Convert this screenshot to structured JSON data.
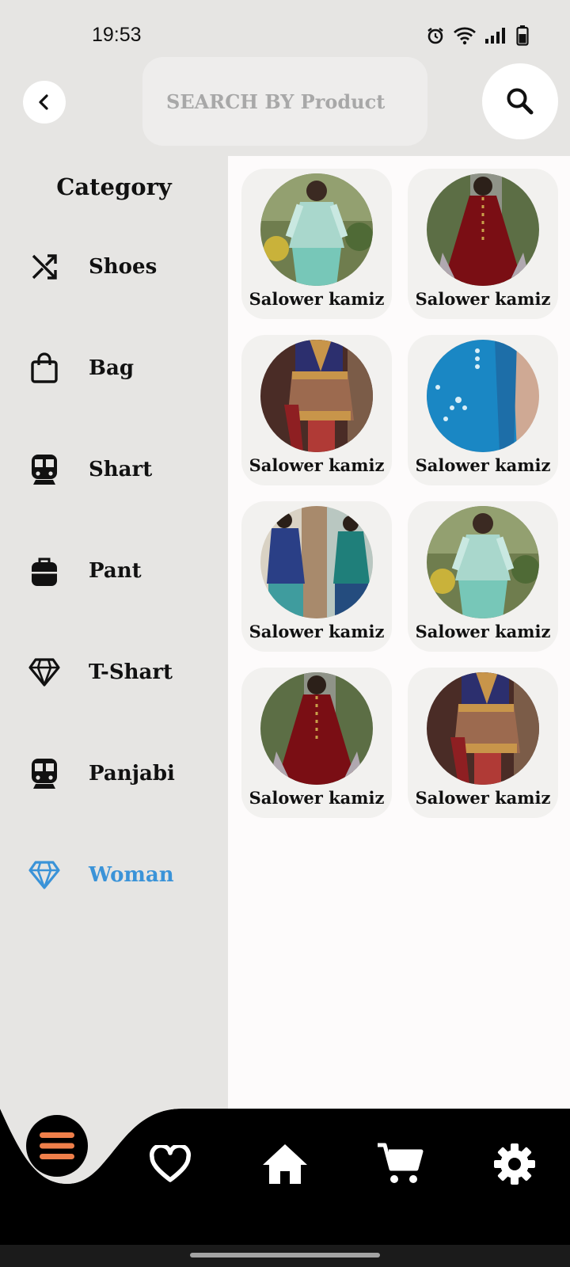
{
  "status_bar": {
    "time": "19:53"
  },
  "header": {
    "search_placeholder": "SEARCH BY Product"
  },
  "sidebar": {
    "title": "Category",
    "items": [
      {
        "label": "Shoes",
        "icon": "shuffle-icon"
      },
      {
        "label": "Bag",
        "icon": "shopping-bag-icon"
      },
      {
        "label": "Shart",
        "icon": "train-icon"
      },
      {
        "label": "Pant",
        "icon": "suitcase-icon"
      },
      {
        "label": "T-Shart",
        "icon": "diamond-icon"
      },
      {
        "label": "Panjabi",
        "icon": "train-icon"
      },
      {
        "label": "Woman",
        "icon": "diamond-icon",
        "active": true
      }
    ],
    "active_color": "#3a93d8"
  },
  "products": [
    {
      "name": "Salower kamiz",
      "outfit": "mint"
    },
    {
      "name": "Salower kamiz",
      "outfit": "maroon"
    },
    {
      "name": "Salower kamiz",
      "outfit": "navy-embroidered"
    },
    {
      "name": "Salower kamiz",
      "outfit": "teal-blue"
    },
    {
      "name": "Salower kamiz",
      "outfit": "navy-teal-duo"
    },
    {
      "name": "Salower kamiz",
      "outfit": "mint"
    },
    {
      "name": "Salower kamiz",
      "outfit": "maroon"
    },
    {
      "name": "Salower kamiz",
      "outfit": "navy-embroidered"
    }
  ],
  "bottom_nav": {
    "items": [
      "menu-icon",
      "heart-icon",
      "home-icon",
      "cart-icon",
      "settings-icon"
    ],
    "menu_accent": "#ef7f4a"
  }
}
